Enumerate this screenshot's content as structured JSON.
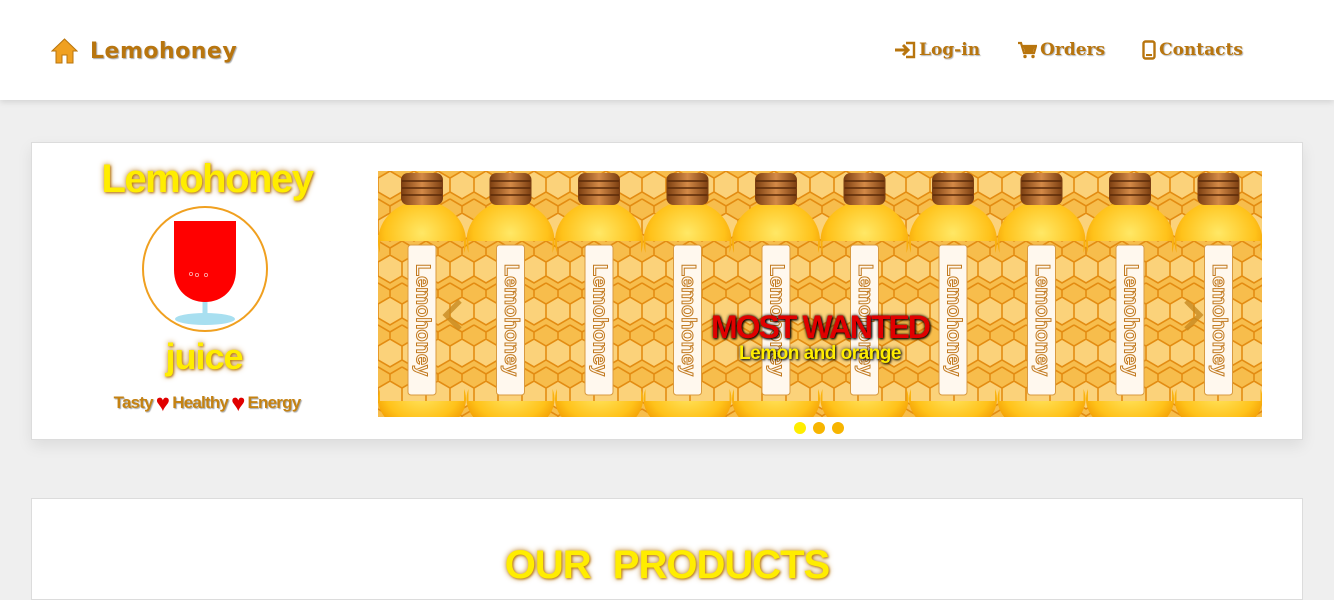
{
  "brand": {
    "name": "Lemohoney",
    "icon": "home-icon",
    "color": "#b8750e"
  },
  "nav": [
    {
      "label": "Log-in",
      "icon": "login-icon"
    },
    {
      "label": "Orders",
      "icon": "cart-icon"
    },
    {
      "label": "Contacts",
      "icon": "phone-icon"
    }
  ],
  "hero": {
    "logo": {
      "title": "Lemohoney",
      "subtitle": "juice",
      "tagline": [
        "Tasty",
        "Healthy",
        "Energy"
      ],
      "tagline_icon": "heart-icon"
    },
    "carousel": {
      "caption_title": "MOST WANTED",
      "caption_subtitle": "Lemon and orange",
      "bottle_label": "Lemohoney",
      "slides": 3,
      "active_slide": 1,
      "prev_icon": "chevron-left-icon",
      "next_icon": "chevron-right-icon"
    }
  },
  "products": {
    "title": "OUR PRODUCTS"
  },
  "colors": {
    "accent": "#b8750e",
    "yellow": "#ffed00",
    "red": "#e00000",
    "orange": "#f7b500"
  }
}
